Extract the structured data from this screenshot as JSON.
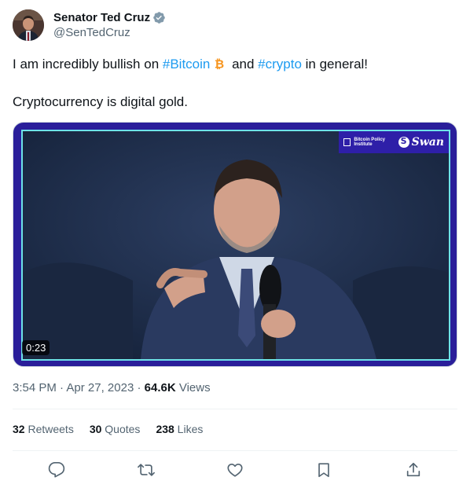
{
  "author": {
    "name": "Senator Ted Cruz",
    "handle": "@SenTedCruz"
  },
  "tweet": {
    "line1_before": "I am incredibly bullish on ",
    "hashtag1": "#Bitcoin",
    "line1_middle": " and ",
    "hashtag2": "#crypto",
    "line1_after": " in general!",
    "line2": "Cryptocurrency is digital gold."
  },
  "media": {
    "overlay_left": "Bitcoin Policy Institute",
    "overlay_right": "Swan",
    "duration": "0:23"
  },
  "meta": {
    "time": "3:54 PM",
    "sep1": " · ",
    "date": "Apr 27, 2023",
    "sep2": " · ",
    "views_count": "64.6K",
    "views_label": " Views"
  },
  "stats": {
    "retweets_count": "32",
    "retweets_label": " Retweets",
    "quotes_count": "30",
    "quotes_label": " Quotes",
    "likes_count": "238",
    "likes_label": " Likes"
  },
  "colors": {
    "link": "#1d9bf0",
    "bitcoin": "#f7931a",
    "verified": "#829aab",
    "media_frame": "#2a1e9a"
  },
  "icons": [
    "verified-badge-icon",
    "bitcoin-icon",
    "reply-icon",
    "retweet-icon",
    "like-icon",
    "bookmark-icon",
    "share-icon"
  ]
}
